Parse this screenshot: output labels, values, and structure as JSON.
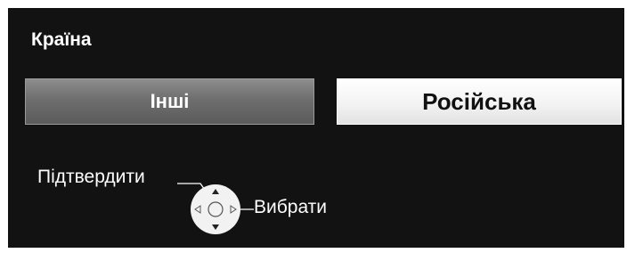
{
  "screen": {
    "title": "Країна",
    "options": [
      {
        "label": "Інші",
        "state": "unselected"
      },
      {
        "label": "Російська",
        "state": "focused"
      }
    ],
    "hints": {
      "confirm_label": "Підтвердити",
      "select_label": "Вибрати"
    },
    "colors": {
      "background": "#121212",
      "text": "#ffffff",
      "focused_bg": "#f3f3f3",
      "unselected_bg": "#6e6e6e"
    },
    "icons": {
      "nav_pad": "remote-dpad-icon"
    }
  }
}
